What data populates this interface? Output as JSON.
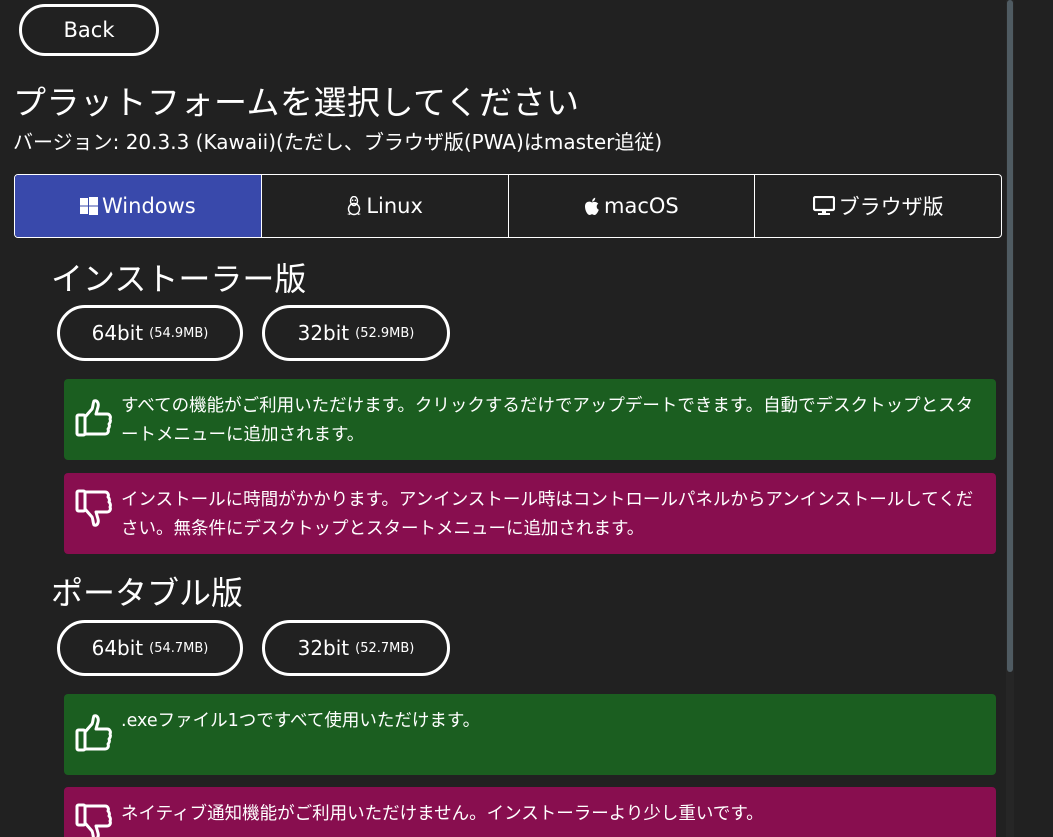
{
  "back_label": "Back",
  "title": "プラットフォームを選択してください",
  "version": "バージョン: 20.3.3 (Kawaii)(ただし、ブラウザ版(PWA)はmaster追従)",
  "tabs": [
    {
      "label": "Windows",
      "icon": "windows-icon",
      "active": true
    },
    {
      "label": "Linux",
      "icon": "linux-icon",
      "active": false
    },
    {
      "label": "macOS",
      "icon": "apple-icon",
      "active": false
    },
    {
      "label": "ブラウザ版",
      "icon": "monitor-icon",
      "active": false
    }
  ],
  "installer": {
    "title": "インストーラー版",
    "buttons": [
      {
        "bits": "64bit",
        "size": "(54.9MB)"
      },
      {
        "bits": "32bit",
        "size": "(52.9MB)"
      }
    ],
    "pro": "すべての機能がご利用いただけます。クリックするだけでアップデートできます。自動でデスクトップとスタートメニューに追加されます。",
    "con": "インストールに時間がかかります。アンインストール時はコントロールパネルからアンインストールしてください。無条件にデスクトップとスタートメニューに追加されます。"
  },
  "portable": {
    "title": "ポータブル版",
    "buttons": [
      {
        "bits": "64bit",
        "size": "(54.7MB)"
      },
      {
        "bits": "32bit",
        "size": "(52.7MB)"
      }
    ],
    "pro": ".exeファイル1つですべて使用いただけます。",
    "con": "ネイティブ通知機能がご利用いただけません。インストーラーより少し重いです。"
  },
  "colors": {
    "background": "#212121",
    "active_tab": "#3949ab",
    "pro": "#1b5e20",
    "con": "#880e4f"
  }
}
